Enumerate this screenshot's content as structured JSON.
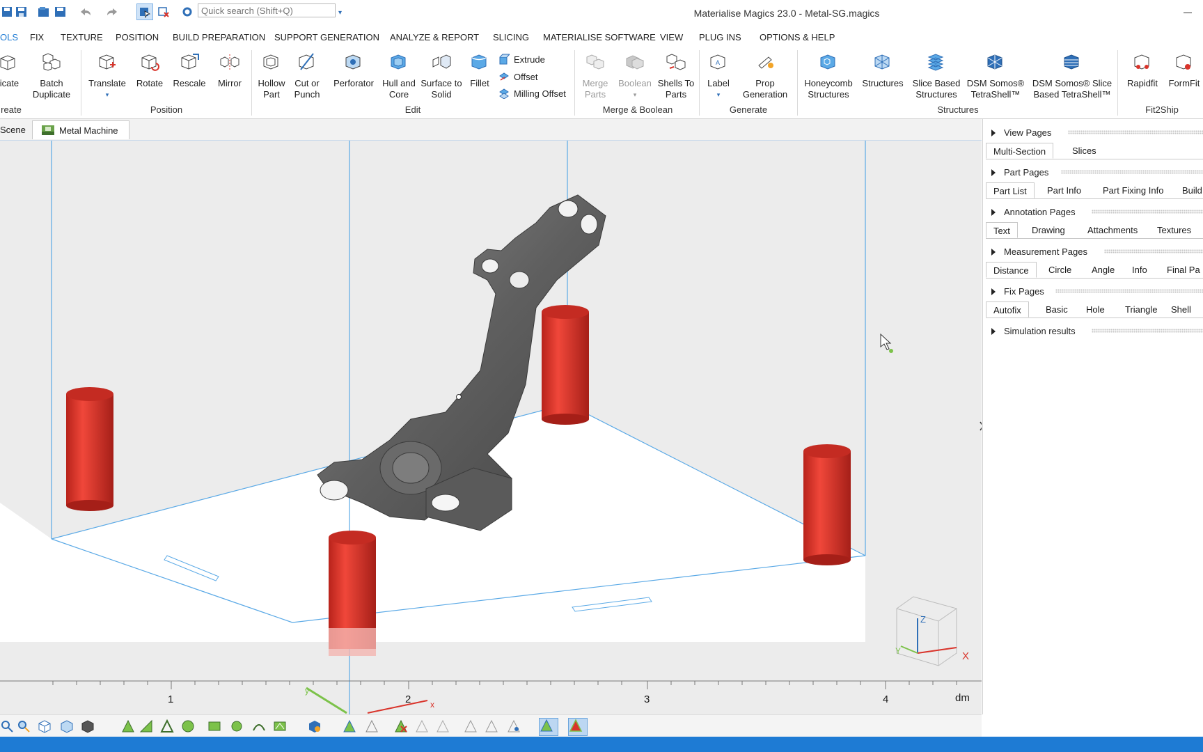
{
  "title_bar": {
    "search_placeholder": "Quick search (Shift+Q)",
    "window_title": "Materialise Magics 23.0 - Metal-SG.magics"
  },
  "menu": [
    "OLS",
    "FIX",
    "TEXTURE",
    "POSITION",
    "BUILD PREPARATION",
    "SUPPORT GENERATION",
    "ANALYZE & REPORT",
    "SLICING",
    "MATERIALISE SOFTWARE",
    "VIEW",
    "PLUG INS",
    "OPTIONS & HELP"
  ],
  "ribbon": {
    "create": {
      "group_label": "reate",
      "buttons": [
        {
          "label": "licate"
        },
        {
          "label": "Batch\nDuplicate"
        }
      ]
    },
    "position": {
      "group_label": "Position",
      "buttons": [
        {
          "label": "Translate"
        },
        {
          "label": "Rotate"
        },
        {
          "label": "Rescale"
        },
        {
          "label": "Mirror"
        }
      ]
    },
    "edit": {
      "group_label": "Edit",
      "buttons": [
        {
          "label": "Hollow\nPart"
        },
        {
          "label": "Cut or\nPunch"
        },
        {
          "label": "Perforator"
        },
        {
          "label": "Hull and\nCore"
        },
        {
          "label": "Surface to\nSolid"
        },
        {
          "label": "Fillet"
        }
      ],
      "small_buttons": [
        "Extrude",
        "Offset",
        "Milling Offset"
      ]
    },
    "merge": {
      "group_label": "Merge & Boolean",
      "buttons": [
        {
          "label": "Merge\nParts"
        },
        {
          "label": "Boolean"
        },
        {
          "label": "Shells To\nParts"
        }
      ]
    },
    "generate": {
      "group_label": "Generate",
      "buttons": [
        {
          "label": "Label"
        },
        {
          "label": "Prop\nGeneration"
        }
      ]
    },
    "structures": {
      "group_label": "Structures",
      "buttons": [
        {
          "label": "Honeycomb\nStructures"
        },
        {
          "label": "Structures"
        },
        {
          "label": "Slice Based\nStructures"
        },
        {
          "label": "DSM Somos®\nTetraShell™"
        },
        {
          "label": "DSM Somos® Slice\nBased TetraShell™"
        }
      ]
    },
    "fit2ship": {
      "group_label": "Fit2Ship",
      "buttons": [
        {
          "label": "Rapidfit"
        },
        {
          "label": "FormFit"
        }
      ]
    }
  },
  "doc_tabs": [
    "Scene",
    "Metal Machine"
  ],
  "viewport": {
    "ruler_ticks": [
      "1",
      "2",
      "3",
      "4"
    ],
    "ruler_unit": "dm",
    "axis_labels": {
      "x": "X",
      "y": "Y",
      "z": "Z"
    },
    "plate_x": "x",
    "plate_y": "y"
  },
  "panel": {
    "sections": [
      {
        "title": "View Pages",
        "tabs": [
          "Multi-Section",
          "Slices"
        ],
        "active": 0
      },
      {
        "title": "Part Pages",
        "tabs": [
          "Part List",
          "Part Info",
          "Part Fixing Info",
          "Build"
        ],
        "active": 0
      },
      {
        "title": "Annotation Pages",
        "tabs": [
          "Text",
          "Drawing",
          "Attachments",
          "Textures"
        ],
        "active": 0
      },
      {
        "title": "Measurement Pages",
        "tabs": [
          "Distance",
          "Circle",
          "Angle",
          "Info",
          "Final Pa"
        ],
        "active": 0
      },
      {
        "title": "Fix Pages",
        "tabs": [
          "Autofix",
          "Basic",
          "Hole",
          "Triangle",
          "Shell"
        ],
        "active": 0
      },
      {
        "title": "Simulation results",
        "tabs": [],
        "active": -1
      }
    ]
  },
  "colors": {
    "accent": "#1e7bd4",
    "support_red": "#e0382c",
    "part_gray": "#6e6e6e",
    "build_box": "#5aa9e6"
  }
}
